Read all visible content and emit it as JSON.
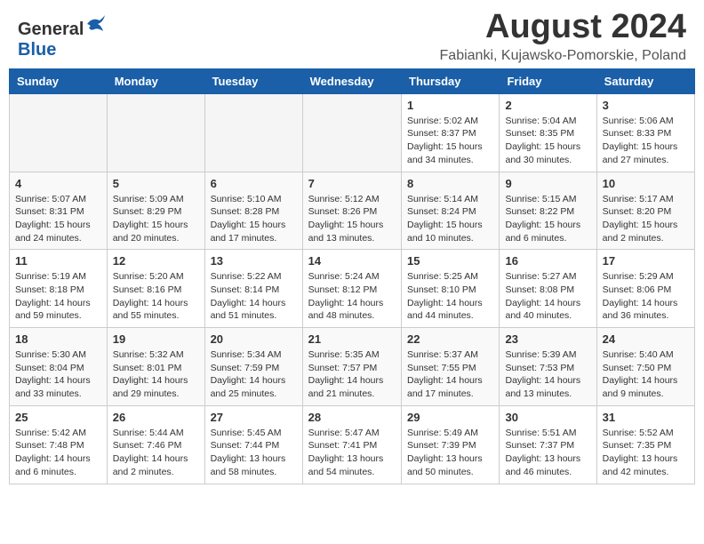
{
  "header": {
    "logo_general": "General",
    "logo_blue": "Blue",
    "month_year": "August 2024",
    "location": "Fabianki, Kujawsko-Pomorskie, Poland"
  },
  "weekdays": [
    "Sunday",
    "Monday",
    "Tuesday",
    "Wednesday",
    "Thursday",
    "Friday",
    "Saturday"
  ],
  "weeks": [
    [
      {
        "day": "",
        "info": ""
      },
      {
        "day": "",
        "info": ""
      },
      {
        "day": "",
        "info": ""
      },
      {
        "day": "",
        "info": ""
      },
      {
        "day": "1",
        "info": "Sunrise: 5:02 AM\nSunset: 8:37 PM\nDaylight: 15 hours\nand 34 minutes."
      },
      {
        "day": "2",
        "info": "Sunrise: 5:04 AM\nSunset: 8:35 PM\nDaylight: 15 hours\nand 30 minutes."
      },
      {
        "day": "3",
        "info": "Sunrise: 5:06 AM\nSunset: 8:33 PM\nDaylight: 15 hours\nand 27 minutes."
      }
    ],
    [
      {
        "day": "4",
        "info": "Sunrise: 5:07 AM\nSunset: 8:31 PM\nDaylight: 15 hours\nand 24 minutes."
      },
      {
        "day": "5",
        "info": "Sunrise: 5:09 AM\nSunset: 8:29 PM\nDaylight: 15 hours\nand 20 minutes."
      },
      {
        "day": "6",
        "info": "Sunrise: 5:10 AM\nSunset: 8:28 PM\nDaylight: 15 hours\nand 17 minutes."
      },
      {
        "day": "7",
        "info": "Sunrise: 5:12 AM\nSunset: 8:26 PM\nDaylight: 15 hours\nand 13 minutes."
      },
      {
        "day": "8",
        "info": "Sunrise: 5:14 AM\nSunset: 8:24 PM\nDaylight: 15 hours\nand 10 minutes."
      },
      {
        "day": "9",
        "info": "Sunrise: 5:15 AM\nSunset: 8:22 PM\nDaylight: 15 hours\nand 6 minutes."
      },
      {
        "day": "10",
        "info": "Sunrise: 5:17 AM\nSunset: 8:20 PM\nDaylight: 15 hours\nand 2 minutes."
      }
    ],
    [
      {
        "day": "11",
        "info": "Sunrise: 5:19 AM\nSunset: 8:18 PM\nDaylight: 14 hours\nand 59 minutes."
      },
      {
        "day": "12",
        "info": "Sunrise: 5:20 AM\nSunset: 8:16 PM\nDaylight: 14 hours\nand 55 minutes."
      },
      {
        "day": "13",
        "info": "Sunrise: 5:22 AM\nSunset: 8:14 PM\nDaylight: 14 hours\nand 51 minutes."
      },
      {
        "day": "14",
        "info": "Sunrise: 5:24 AM\nSunset: 8:12 PM\nDaylight: 14 hours\nand 48 minutes."
      },
      {
        "day": "15",
        "info": "Sunrise: 5:25 AM\nSunset: 8:10 PM\nDaylight: 14 hours\nand 44 minutes."
      },
      {
        "day": "16",
        "info": "Sunrise: 5:27 AM\nSunset: 8:08 PM\nDaylight: 14 hours\nand 40 minutes."
      },
      {
        "day": "17",
        "info": "Sunrise: 5:29 AM\nSunset: 8:06 PM\nDaylight: 14 hours\nand 36 minutes."
      }
    ],
    [
      {
        "day": "18",
        "info": "Sunrise: 5:30 AM\nSunset: 8:04 PM\nDaylight: 14 hours\nand 33 minutes."
      },
      {
        "day": "19",
        "info": "Sunrise: 5:32 AM\nSunset: 8:01 PM\nDaylight: 14 hours\nand 29 minutes."
      },
      {
        "day": "20",
        "info": "Sunrise: 5:34 AM\nSunset: 7:59 PM\nDaylight: 14 hours\nand 25 minutes."
      },
      {
        "day": "21",
        "info": "Sunrise: 5:35 AM\nSunset: 7:57 PM\nDaylight: 14 hours\nand 21 minutes."
      },
      {
        "day": "22",
        "info": "Sunrise: 5:37 AM\nSunset: 7:55 PM\nDaylight: 14 hours\nand 17 minutes."
      },
      {
        "day": "23",
        "info": "Sunrise: 5:39 AM\nSunset: 7:53 PM\nDaylight: 14 hours\nand 13 minutes."
      },
      {
        "day": "24",
        "info": "Sunrise: 5:40 AM\nSunset: 7:50 PM\nDaylight: 14 hours\nand 9 minutes."
      }
    ],
    [
      {
        "day": "25",
        "info": "Sunrise: 5:42 AM\nSunset: 7:48 PM\nDaylight: 14 hours\nand 6 minutes."
      },
      {
        "day": "26",
        "info": "Sunrise: 5:44 AM\nSunset: 7:46 PM\nDaylight: 14 hours\nand 2 minutes."
      },
      {
        "day": "27",
        "info": "Sunrise: 5:45 AM\nSunset: 7:44 PM\nDaylight: 13 hours\nand 58 minutes."
      },
      {
        "day": "28",
        "info": "Sunrise: 5:47 AM\nSunset: 7:41 PM\nDaylight: 13 hours\nand 54 minutes."
      },
      {
        "day": "29",
        "info": "Sunrise: 5:49 AM\nSunset: 7:39 PM\nDaylight: 13 hours\nand 50 minutes."
      },
      {
        "day": "30",
        "info": "Sunrise: 5:51 AM\nSunset: 7:37 PM\nDaylight: 13 hours\nand 46 minutes."
      },
      {
        "day": "31",
        "info": "Sunrise: 5:52 AM\nSunset: 7:35 PM\nDaylight: 13 hours\nand 42 minutes."
      }
    ]
  ]
}
